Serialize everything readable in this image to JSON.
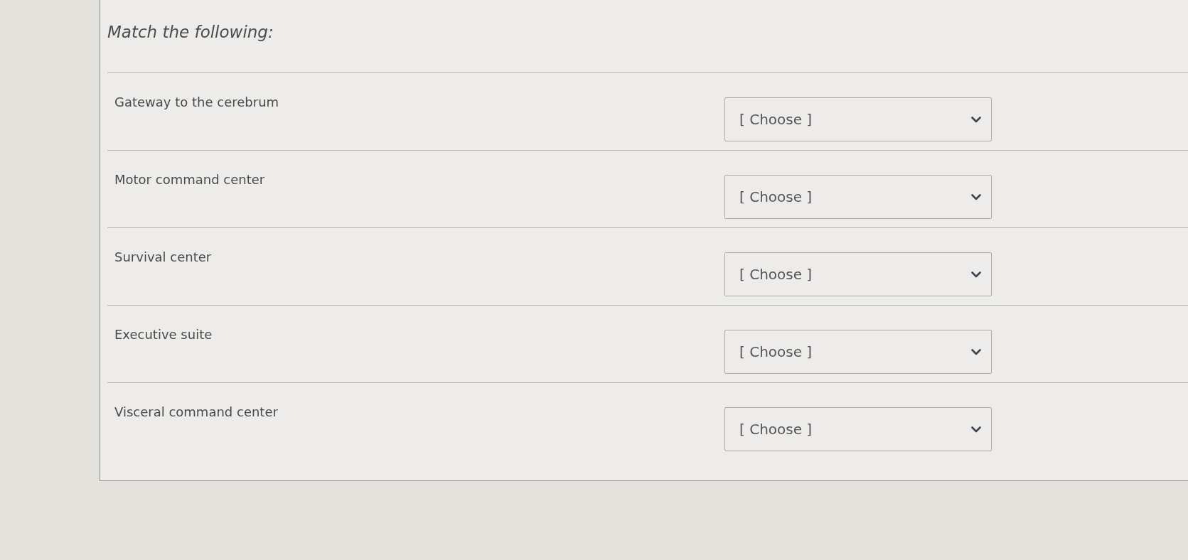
{
  "question": {
    "title": "Match the following:"
  },
  "items": [
    {
      "prompt": "Gateway to the cerebrum",
      "answer": "[ Choose ]"
    },
    {
      "prompt": "Motor command center",
      "answer": "[ Choose ]"
    },
    {
      "prompt": "Survival center",
      "answer": "[ Choose ]"
    },
    {
      "prompt": "Executive suite",
      "answer": "[ Choose ]"
    },
    {
      "prompt": "Visceral command center",
      "answer": "[ Choose ]"
    }
  ]
}
